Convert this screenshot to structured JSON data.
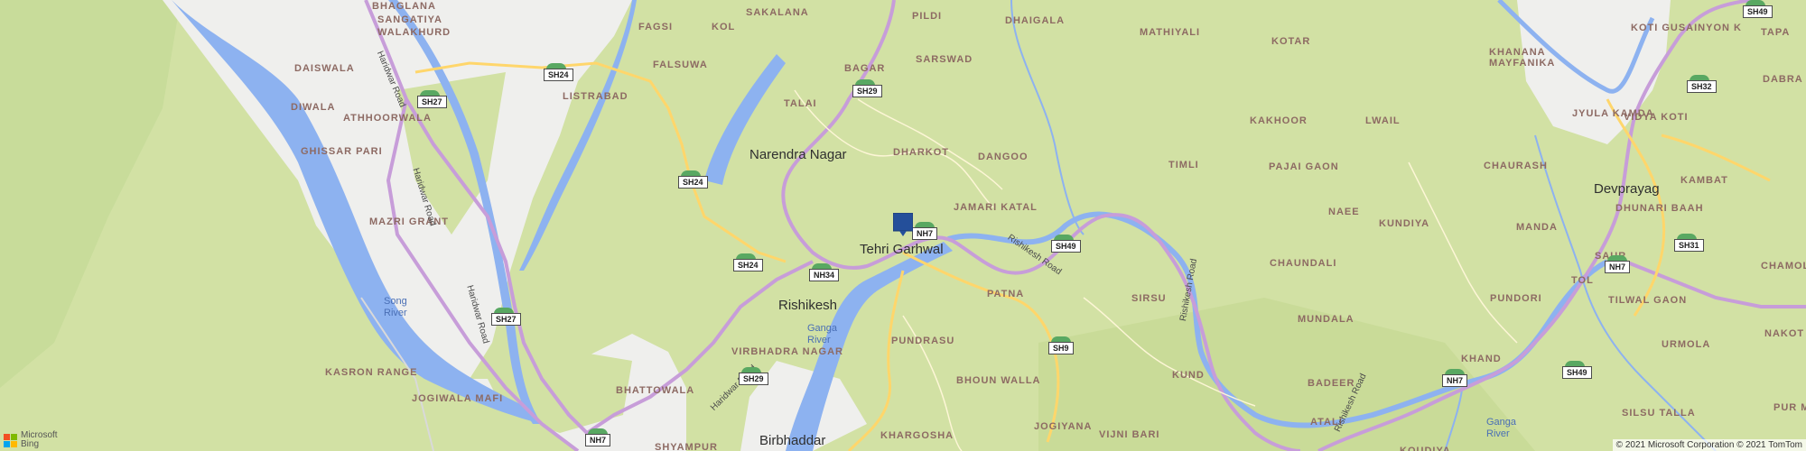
{
  "map": {
    "villages": [
      "BHAGLANA",
      "SANGATIYA",
      "WALAKHURD",
      "DAISWALA",
      "DIWALA",
      "ATHHOORWALA",
      "GHISSAR PARI",
      "MAZRI GRANT",
      "KASRON RANGE",
      "JOGIWALA MAFI",
      "FAGSI",
      "KOL",
      "FALSUWA",
      "LISTRABAD",
      "SAKALANA",
      "PILDI",
      "BAGAR",
      "SARSWAD",
      "TALAI",
      "DHARKOT",
      "DANGOO",
      "JAMARI KATAL",
      "DHAIGALA",
      "MATHIYALI",
      "KOTAR",
      "KAKHOOR",
      "LWAIL",
      "PAJAI GAON",
      "TIMLI",
      "NAEE",
      "CHAUNDALI",
      "SIRSU",
      "MUNDALA",
      "KUNDIYA",
      "PATNA",
      "PUNDRASU",
      "BHOUN WALLA",
      "BHATTOWALA",
      "VIRBHADRA NAGAR",
      "SHYAMPUR",
      "KHARGOSHA",
      "JOGIYANA",
      "VIJNI BARI",
      "KUND",
      "ATALI",
      "BADEER",
      "KOUDIYA",
      "KHAND",
      "PUNDORI",
      "MANDA",
      "CHAURASH",
      "KOTI GUSAINYON K",
      "TAPA",
      "KHANANA",
      "MAYFANIKA",
      "JYULA KAMDA",
      "VIDYA KOTI",
      "DABRA",
      "KAMBAT",
      "DHUNARI BAAH",
      "SAUR",
      "CHAMOLI",
      "TOL",
      "TILWAL GAON",
      "URMOLA",
      "NAKOT BHA",
      "PUR MUSI",
      "SILSU TALLA"
    ],
    "towns": [
      "Narendra Nagar",
      "Tehri Garhwal",
      "Rishikesh",
      "Birbhaddar",
      "Devprayag"
    ],
    "water_labels": [
      "Song",
      "River",
      "Ganga",
      "River",
      "Ganga",
      "River"
    ],
    "road_labels": [
      "Haridwar Road",
      "Haridwar Road",
      "Haridwar Road",
      "Haridwar Road",
      "Rishikesh Road",
      "Rishikesh Road",
      "Rishikesh Road"
    ],
    "shields": [
      "SH24",
      "SH27",
      "SH27",
      "SH29",
      "SH24",
      "SH24",
      "NH34",
      "NH7",
      "SH49",
      "SH9",
      "SH29",
      "NH7",
      "SH49",
      "NH7",
      "SH31",
      "SH32",
      "SH49",
      "NH7"
    ],
    "location_pin": "location-pin",
    "attribution": {
      "brand_line1": "Microsoft",
      "brand_line2": "Bing",
      "copyright": "© 2021 Microsoft Corporation © 2021 TomTom"
    },
    "colors": {
      "land": "#d2e1a4",
      "urban": "#efefed",
      "water": "#8db2f0",
      "highway": "#c79dd9",
      "state_road": "#ffd66b",
      "shield_green": "#59a862",
      "pin": "#244f9a"
    }
  }
}
